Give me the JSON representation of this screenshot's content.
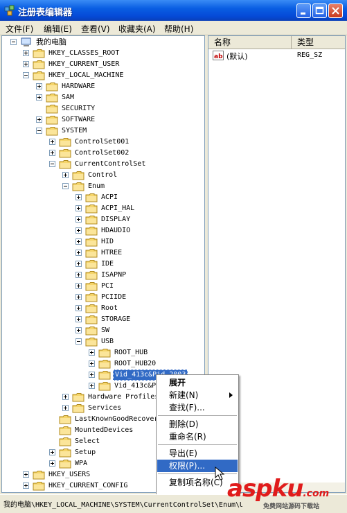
{
  "window": {
    "title": "注册表编辑器"
  },
  "menu": [
    {
      "label": "文件(F)"
    },
    {
      "label": "编辑(E)"
    },
    {
      "label": "查看(V)"
    },
    {
      "label": "收藏夹(A)"
    },
    {
      "label": "帮助(H)"
    }
  ],
  "tree": {
    "root": "我的电脑",
    "nodes": [
      {
        "label": "HKEY_CLASSES_ROOT",
        "expander": "plus"
      },
      {
        "label": "HKEY_CURRENT_USER",
        "expander": "plus"
      },
      {
        "label": "HKEY_LOCAL_MACHINE",
        "expander": "minus"
      },
      {
        "label": "HARDWARE",
        "expander": "plus"
      },
      {
        "label": "SAM",
        "expander": "plus"
      },
      {
        "label": "SECURITY",
        "expander": "none"
      },
      {
        "label": "SOFTWARE",
        "expander": "plus"
      },
      {
        "label": "SYSTEM",
        "expander": "minus"
      },
      {
        "label": "ControlSet001",
        "expander": "plus"
      },
      {
        "label": "ControlSet002",
        "expander": "plus"
      },
      {
        "label": "CurrentControlSet",
        "expander": "minus"
      },
      {
        "label": "Control",
        "expander": "plus"
      },
      {
        "label": "Enum",
        "expander": "minus"
      },
      {
        "label": "ACPI",
        "expander": "plus"
      },
      {
        "label": "ACPI_HAL",
        "expander": "plus"
      },
      {
        "label": "DISPLAY",
        "expander": "plus"
      },
      {
        "label": "HDAUDIO",
        "expander": "plus"
      },
      {
        "label": "HID",
        "expander": "plus"
      },
      {
        "label": "HTREE",
        "expander": "plus"
      },
      {
        "label": "IDE",
        "expander": "plus"
      },
      {
        "label": "ISAPNP",
        "expander": "plus"
      },
      {
        "label": "PCI",
        "expander": "plus"
      },
      {
        "label": "PCIIDE",
        "expander": "plus"
      },
      {
        "label": "Root",
        "expander": "plus"
      },
      {
        "label": "STORAGE",
        "expander": "plus"
      },
      {
        "label": "SW",
        "expander": "plus"
      },
      {
        "label": "USB",
        "expander": "minus"
      },
      {
        "label": "ROOT_HUB",
        "expander": "plus"
      },
      {
        "label": "ROOT_HUB20",
        "expander": "plus"
      },
      {
        "label": "Vid_413c&Pid_2003",
        "expander": "plus",
        "selected": true
      },
      {
        "label": "Vid_413c&P",
        "expander": "plus"
      },
      {
        "label": "Hardware Profiles",
        "expander": "plus"
      },
      {
        "label": "Services",
        "expander": "plus"
      },
      {
        "label": "LastKnownGoodRecover",
        "expander": "none"
      },
      {
        "label": "MountedDevices",
        "expander": "none"
      },
      {
        "label": "Select",
        "expander": "none"
      },
      {
        "label": "Setup",
        "expander": "plus"
      },
      {
        "label": "WPA",
        "expander": "plus"
      },
      {
        "label": "HKEY_USERS",
        "expander": "plus"
      },
      {
        "label": "HKEY_CURRENT_CONFIG",
        "expander": "plus"
      }
    ]
  },
  "list": {
    "columns": [
      "名称",
      "类型"
    ],
    "rows": [
      {
        "name": "(默认)",
        "type": "REG_SZ",
        "icon": "string-value-icon"
      }
    ]
  },
  "context_menu": {
    "items": [
      {
        "label": "展开",
        "bold": true
      },
      {
        "label": "新建(N)",
        "submenu": true
      },
      {
        "label": "查找(F)..."
      },
      {
        "label": "删除(D)"
      },
      {
        "label": "重命名(R)"
      },
      {
        "label": "导出(E)"
      },
      {
        "label": "权限(P)...",
        "highlighted": true
      },
      {
        "label": "复制项名称(C)"
      }
    ]
  },
  "status_bar": {
    "path": "我的电脑\\HKEY_LOCAL_MACHINE\\SYSTEM\\CurrentControlSet\\Enum\\USB\\Vid_413c&Pid_2003"
  },
  "watermark": {
    "brand": "aspku",
    "tld": ".com",
    "subtitle": "免费网站源码下载站"
  }
}
